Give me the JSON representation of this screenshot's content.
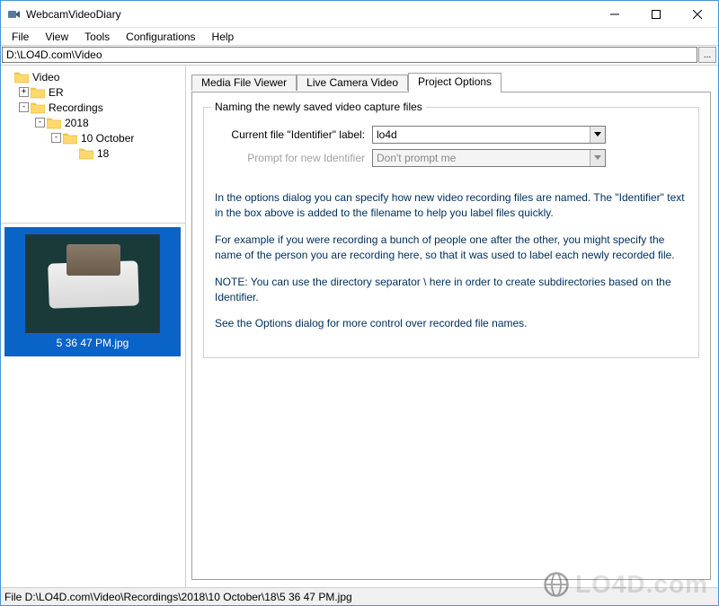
{
  "window": {
    "title": "WebcamVideoDiary"
  },
  "menubar": {
    "file": "File",
    "view": "View",
    "tools": "Tools",
    "configurations": "Configurations",
    "help": "Help"
  },
  "pathbar": {
    "value": "D:\\LO4D.com\\Video",
    "browse_label": "..."
  },
  "tree": {
    "items": [
      {
        "indent": 0,
        "expander": "",
        "label": "Video"
      },
      {
        "indent": 1,
        "expander": "+",
        "label": "ER"
      },
      {
        "indent": 1,
        "expander": "-",
        "label": "Recordings"
      },
      {
        "indent": 2,
        "expander": "-",
        "label": "2018"
      },
      {
        "indent": 3,
        "expander": "-",
        "label": "10 October"
      },
      {
        "indent": 4,
        "expander": "",
        "label": "18"
      }
    ]
  },
  "thumbnail": {
    "filename": "5 36 47 PM.jpg"
  },
  "tabs": {
    "items": [
      {
        "label": "Media File Viewer",
        "active": false
      },
      {
        "label": "Live Camera Video",
        "active": false
      },
      {
        "label": "Project Options",
        "active": true
      }
    ]
  },
  "project_options": {
    "group_title": "Naming the newly saved video capture files",
    "identifier_label": "Current file \"Identifier\" label:",
    "identifier_value": "lo4d",
    "prompt_label": "Prompt for new Identifier",
    "prompt_value": "Don't prompt me",
    "info_1": "In the options dialog you can specify how new video recording files are named.  The \"Identifier\" text in the box above is added to the filename to help you label files quickly.",
    "info_2": "For example if you were recording a bunch of people one after the other, you might specify the name of the person you are recording here, so that it was used to label each newly recorded file.",
    "info_3": "NOTE: You can use the directory separator \\ here in order to create subdirectories based on the Identifier.",
    "info_4": "See the Options dialog for more control over recorded file names."
  },
  "statusbar": {
    "text": "File D:\\LO4D.com\\Video\\Recordings\\2018\\10 October\\18\\5 36 47 PM.jpg"
  },
  "watermark": {
    "text": "LO4D.com"
  }
}
